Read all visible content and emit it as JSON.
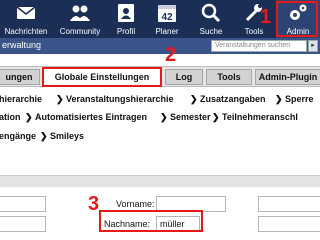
{
  "nav": {
    "items": [
      {
        "label": "Nachrichten",
        "icon": "envelope-icon"
      },
      {
        "label": "Community",
        "icon": "people-icon"
      },
      {
        "label": "Profil",
        "icon": "profile-card-icon"
      },
      {
        "label": "Planer",
        "icon": "calendar-icon",
        "day": "42"
      },
      {
        "label": "Suche",
        "icon": "search-icon"
      },
      {
        "label": "Tools",
        "icon": "wrench-icon"
      },
      {
        "label": "Admin",
        "icon": "gears-icon"
      }
    ]
  },
  "subheader": {
    "title": "erwaltung",
    "search_placeholder": "Veranstaltungen suchen"
  },
  "tabs": [
    {
      "label": "ungen"
    },
    {
      "label": "Globale Einstellungen",
      "active": true
    },
    {
      "label": "Log"
    },
    {
      "label": "Tools"
    },
    {
      "label": "Admin-Plugin"
    }
  ],
  "crumbs": {
    "row1": [
      "hierarchie",
      "Veranstaltungshierarchie",
      "Zusatzangaben",
      "Sperre"
    ],
    "row2": [
      "ation",
      "Automatisiertes Eintragen",
      "Semester",
      "Teilnehmeranschl"
    ],
    "row3": [
      "engänge",
      "Smileys"
    ]
  },
  "form": {
    "vorname_label": "Vorname:",
    "vorname_value": "",
    "nachname_label": "Nachname:",
    "nachname_value": "müller"
  },
  "annotations": {
    "one": "1",
    "two": "2",
    "three": "3"
  },
  "colors": {
    "nav_bg": "#1b2e56",
    "highlight": "#e41919"
  }
}
